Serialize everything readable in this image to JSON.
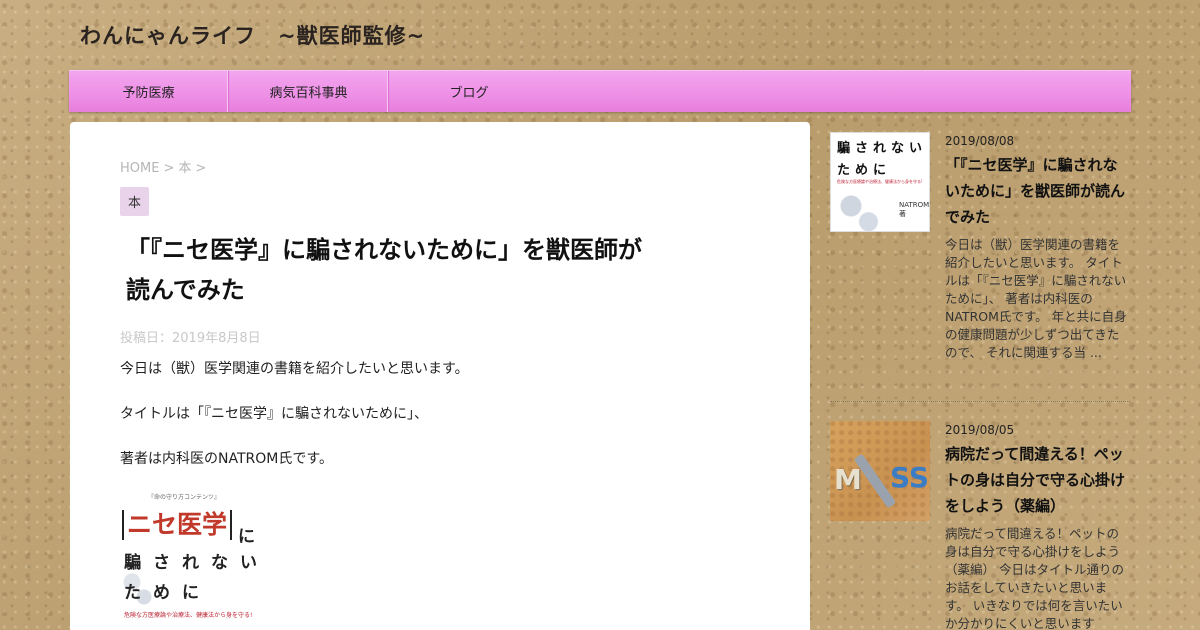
{
  "site": {
    "title": "わんにゃんライフ　~獣医師監修~"
  },
  "nav": {
    "items": [
      "予防医療",
      "病気百科事典",
      "ブログ"
    ]
  },
  "breadcrumb": {
    "home": "HOME",
    "sep": ">",
    "category": "本"
  },
  "post": {
    "category_badge": "本",
    "title_line1": "「『ニセ医学』に騙されないために」を獣医師が",
    "title_line2": "読んでみた",
    "date": "投稿日：2019年8月8日",
    "paragraphs": [
      "今日は（獣）医学関連の書籍を紹介したいと思います。",
      "タイトルは「『ニセ医学』に騙されないために」、",
      "著者は内科医のNATROM氏です。"
    ],
    "book_image": {
      "top_small": "『命の守り方コンテンツ』",
      "title": "ニセ医学",
      "ni": "に",
      "line2": "騙されない",
      "line3": "ために",
      "subtitle": "危険な方医療論や治療法、健康法から身を守る!"
    }
  },
  "sidebar": {
    "items": [
      {
        "date": "2019/08/08",
        "title": "「『ニセ医学』に騙されないために」を獣医師が読んでみた",
        "excerpt": "今日は（獣）医学関連の書籍を紹介したいと思います。 タイトルは「『ニセ医学』に騙されないために」、 著者は内科医のNATROM氏です。 年と共に自身の健康問題が少しずつ出てきたので、 それに関連する当 ...",
        "thumb": {
          "line1": "騙されない",
          "line2": "ために",
          "sub": "危険な方医療論や治療法、健康法から身を守る!",
          "author": "NATROM著"
        }
      },
      {
        "date": "2019/08/05",
        "title": "病院だって間違える！ペットの身は自分で守る心掛けをしよう（薬編）",
        "excerpt": "病院だって間違える！ペットの身は自分で守る心掛けをしよう（薬編） 今日はタイトル通りのお話をしていきたいと思います。 いきなりでは何を言いたいか分かりにくいと思います",
        "thumb": {
          "letters_left": "M",
          "letters_right": "SS"
        }
      }
    ]
  }
}
